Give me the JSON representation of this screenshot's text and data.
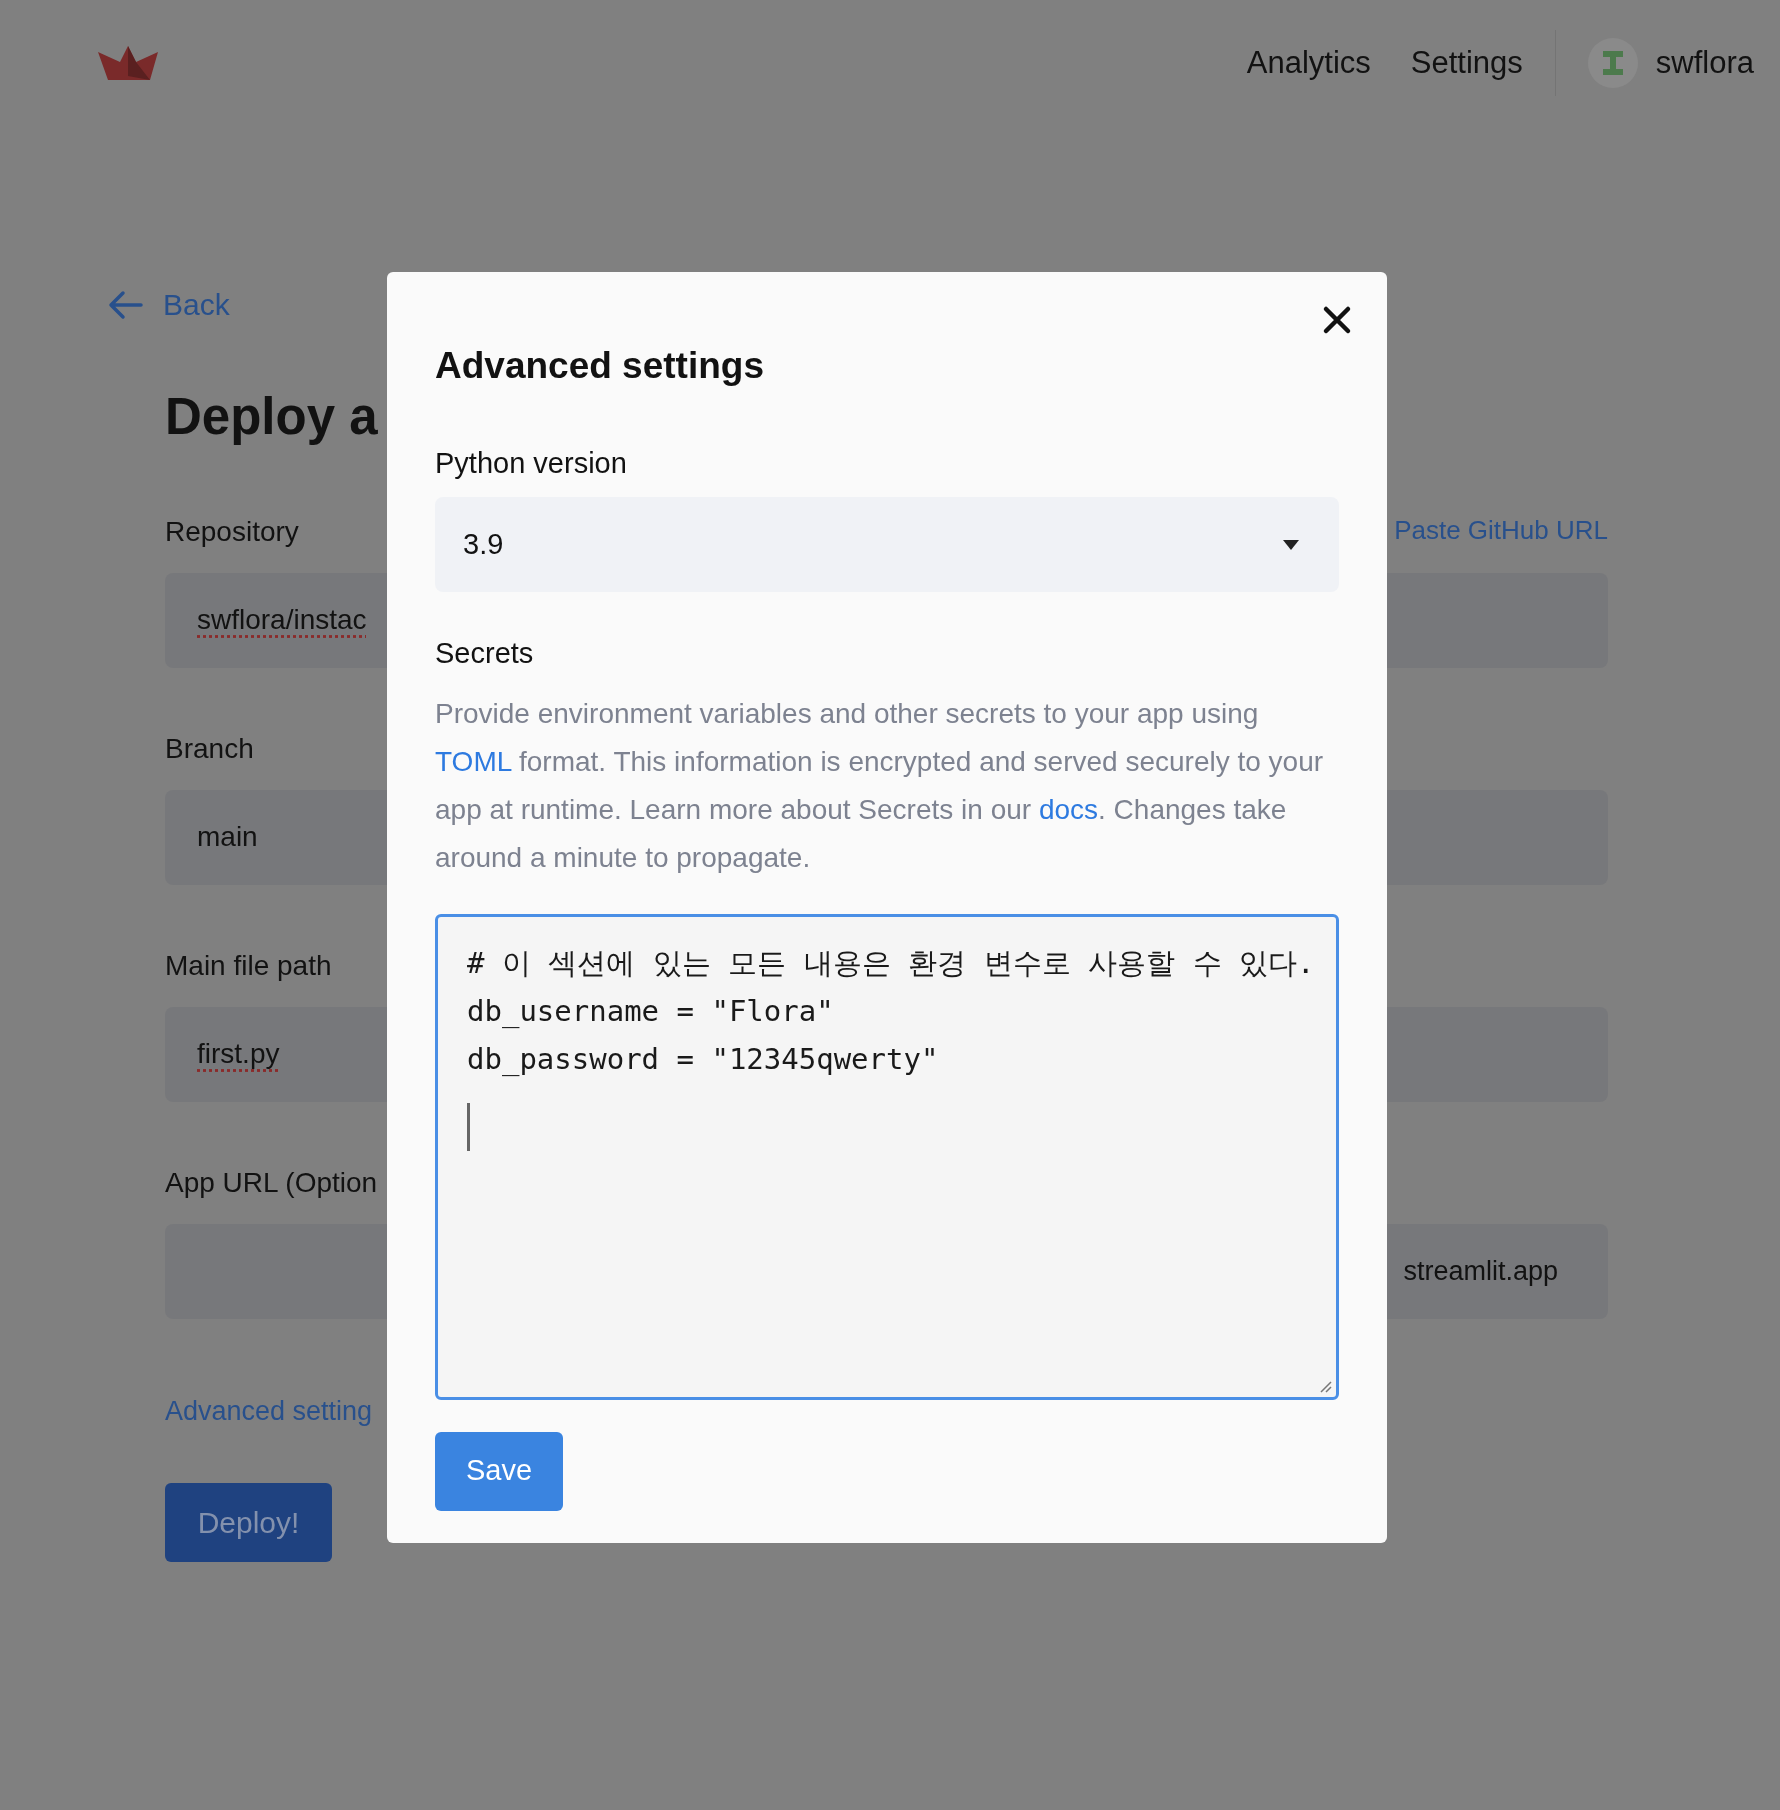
{
  "nav": {
    "links": [
      {
        "label": "Analytics"
      },
      {
        "label": "Settings"
      }
    ],
    "user": {
      "name": "swflora"
    }
  },
  "page": {
    "back": "Back",
    "title": "Deploy a",
    "fields": [
      {
        "label": "Repository",
        "value": "swflora/instac",
        "misspelled": true,
        "link": "Paste GitHub URL"
      },
      {
        "label": "Branch",
        "value": "main",
        "misspelled": false
      },
      {
        "label": "Main file path",
        "value": "first.py",
        "misspelled": true
      },
      {
        "label": "App URL (Option",
        "suffix": "streamlit.app"
      }
    ],
    "advanced_link": "Advanced setting",
    "deploy_button": "Deploy!"
  },
  "modal": {
    "title": "Advanced settings",
    "python_label": "Python version",
    "python_value": "3.9",
    "secrets_label": "Secrets",
    "secrets_help": [
      {
        "kind": "text",
        "text": "Provide environment variables and other secrets to your app using "
      },
      {
        "kind": "link",
        "text": "TOML"
      },
      {
        "kind": "text",
        "text": " format. This information is encrypted and served securely to your app at runtime. Learn more about Secrets in our "
      },
      {
        "kind": "link",
        "text": "docs"
      },
      {
        "kind": "text",
        "text": ". Changes take around a minute to propagate."
      }
    ],
    "secrets_lines": [
      "# 이 섹션에 있는 모든 내용은 환경 변수로 사용할 수 있다.",
      "db_username = \"Flora\"",
      "db_password = \"12345qwerty\""
    ],
    "save_button": "Save"
  }
}
